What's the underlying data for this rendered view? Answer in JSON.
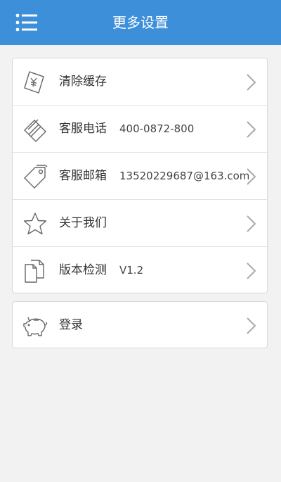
{
  "header": {
    "title": "更多设置",
    "menu_icon": "hamburger-menu-icon",
    "background_color": "#3d8fd9"
  },
  "settings": {
    "items": [
      {
        "label": "清除缓存",
        "value": "",
        "icon": "ticket-icon"
      },
      {
        "label": "客服电话",
        "value": "400-0872-800",
        "icon": "cards-icon"
      },
      {
        "label": "客服邮箱",
        "value": "13520229687@163.com",
        "icon": "tag-icon"
      },
      {
        "label": "关于我们",
        "value": "",
        "icon": "star-icon"
      },
      {
        "label": "版本检测",
        "value": "V1.2",
        "icon": "documents-icon"
      }
    ]
  },
  "account": {
    "login_label": "登录",
    "icon": "piggy-bank-icon"
  }
}
